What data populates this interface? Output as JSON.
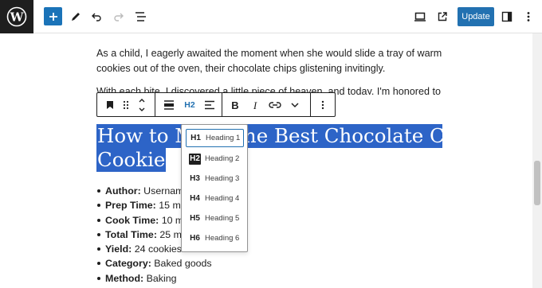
{
  "topbar": {
    "update_label": "Update"
  },
  "content": {
    "paragraph1": "As a child, I eagerly awaited the moment when she would slide a tray of warm cookies out of the oven, their chocolate chips glistening invitingly.",
    "paragraph2": "With each bite, I discovered a little piece of heaven, and today, I'm honored to",
    "heading_line1": "How to Make the Best Chocolate Chip",
    "heading_line2": "Cookies",
    "list": [
      {
        "label": "Author:",
        "value": " Usernam"
      },
      {
        "label": "Prep Time:",
        "value": " 15 mi"
      },
      {
        "label": "Cook Time:",
        "value": " 10 m"
      },
      {
        "label": "Total Time:",
        "value": " 25 m"
      },
      {
        "label": "Yield:",
        "value": " 24 cookies"
      },
      {
        "label": "Category:",
        "value": " Baked goods"
      },
      {
        "label": "Method:",
        "value": " Baking"
      }
    ]
  },
  "block_toolbar": {
    "heading_level": "H2"
  },
  "heading_dropdown": {
    "items": [
      {
        "tag": "H1",
        "label": "Heading 1"
      },
      {
        "tag": "H2",
        "label": "Heading 2"
      },
      {
        "tag": "H3",
        "label": "Heading 3"
      },
      {
        "tag": "H4",
        "label": "Heading 4"
      },
      {
        "tag": "H5",
        "label": "Heading 5"
      },
      {
        "tag": "H6",
        "label": "Heading 6"
      }
    ],
    "focused": "H1",
    "selected": "H2"
  },
  "colors": {
    "accent": "#2271b1",
    "selection": "#2d64c7",
    "dark": "#1e1e1e"
  }
}
